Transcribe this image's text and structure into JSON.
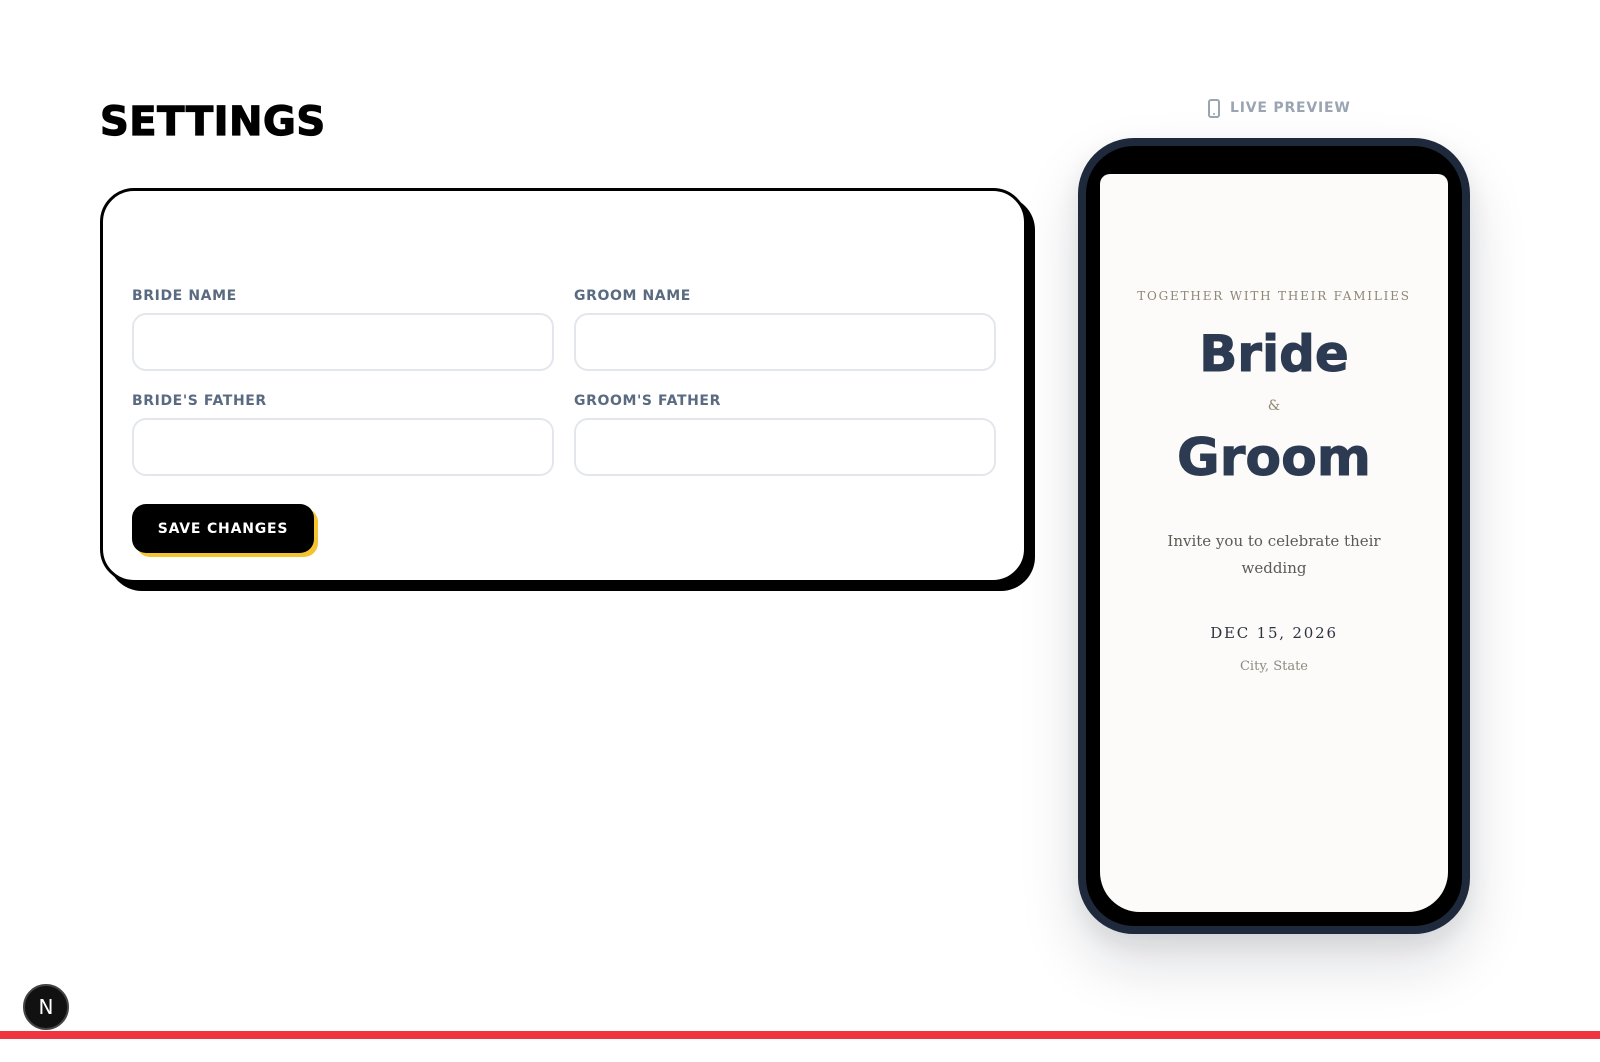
{
  "page": {
    "title": "SETTINGS"
  },
  "form": {
    "bride_name": {
      "label": "BRIDE NAME",
      "value": "",
      "placeholder": ""
    },
    "groom_name": {
      "label": "GROOM NAME",
      "value": "",
      "placeholder": ""
    },
    "brides_father": {
      "label": "BRIDE'S FATHER",
      "value": "",
      "placeholder": ""
    },
    "grooms_father": {
      "label": "GROOM'S FATHER",
      "value": "",
      "placeholder": ""
    },
    "save_label": "SAVE CHANGES"
  },
  "preview": {
    "header_label": "LIVE PREVIEW",
    "header_icon": "smartphone-icon",
    "invitation": {
      "intro": "TOGETHER WITH THEIR FAMILIES",
      "bride": "Bride",
      "ampersand": "&",
      "groom": "Groom",
      "message": "Invite you to celebrate their wedding",
      "date": "DEC 15, 2026",
      "location": "City, State"
    }
  },
  "dev_indicator": {
    "label": "N",
    "icon": "nextjs-logo-icon"
  },
  "colors": {
    "accent_shadow": "#f4c430",
    "label_text": "#5a6a80",
    "heading_navy": "#2d3b52",
    "bottom_bar": "#ef3340"
  }
}
